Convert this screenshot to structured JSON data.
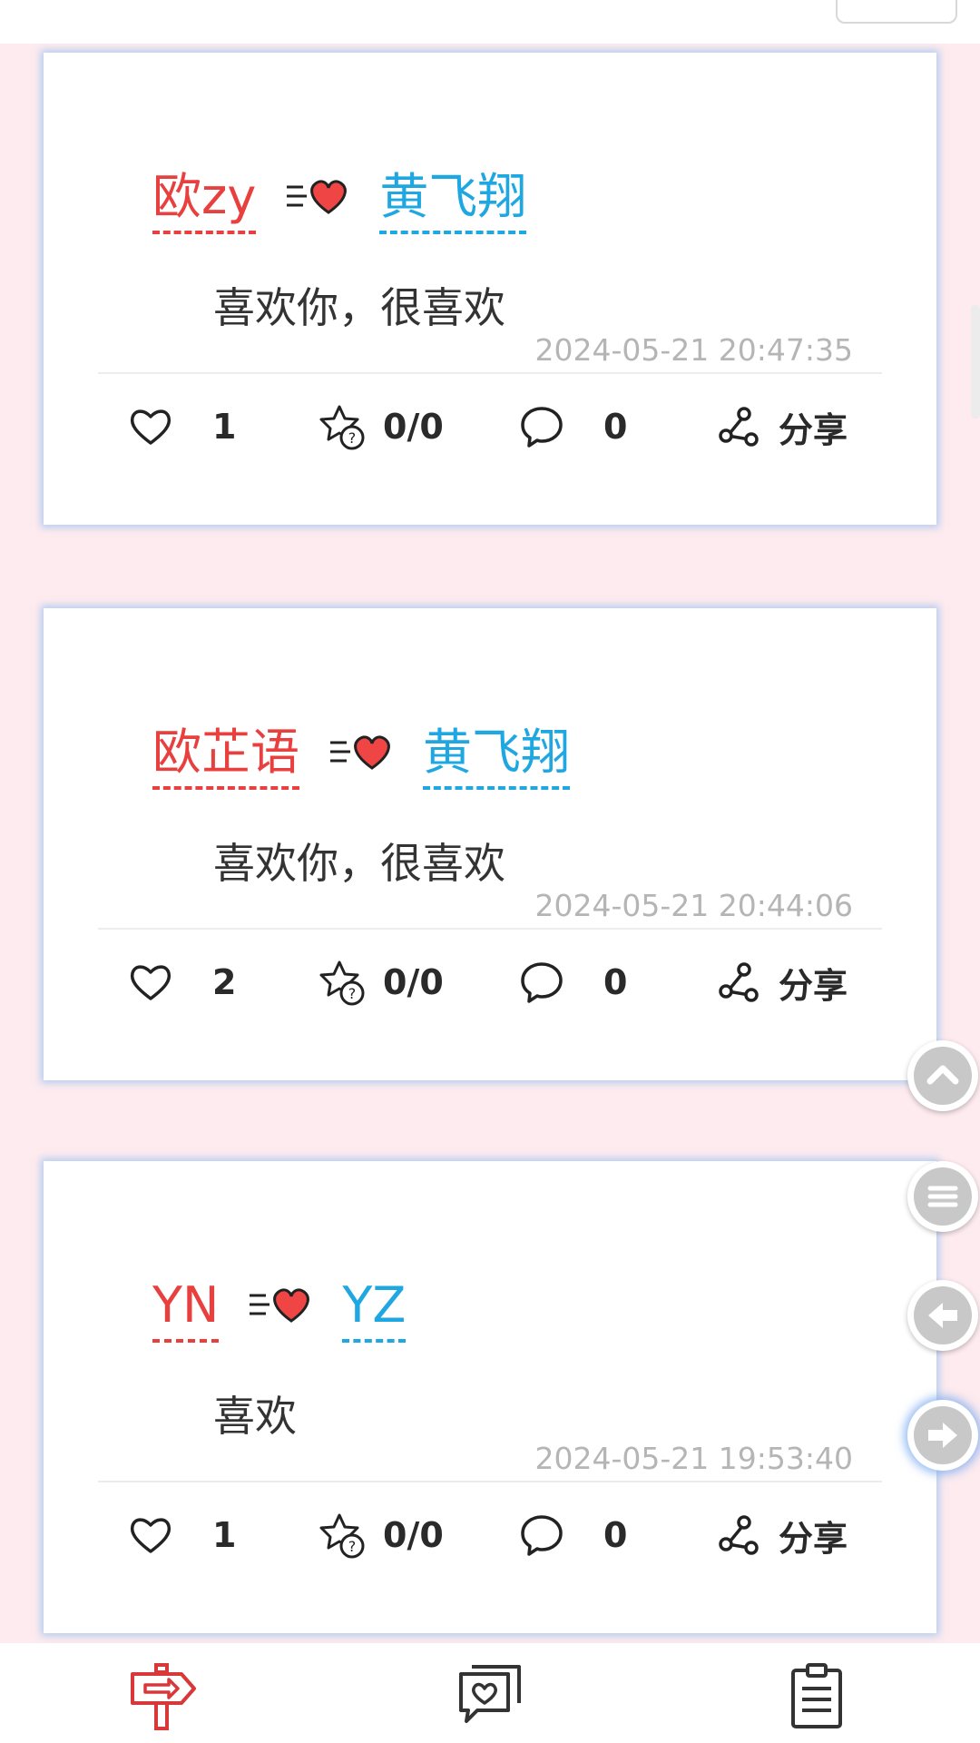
{
  "colors": {
    "background": "#fdebef",
    "from_name": "#e8403f",
    "to_name": "#1ea7e1",
    "timestamp": "#b5b5b5",
    "card_glow": "#78b4f0"
  },
  "feed": {
    "posts": [
      {
        "from": "欧zy",
        "to": "黄飞翔",
        "message": "喜欢你，很喜欢",
        "time": "2024-05-21 20:47:35",
        "likes": "1",
        "bets": "0/0",
        "comments": "0",
        "share": "分享"
      },
      {
        "from": "欧芷语",
        "to": "黄飞翔",
        "message": "喜欢你，很喜欢",
        "time": "2024-05-21 20:44:06",
        "likes": "2",
        "bets": "0/0",
        "comments": "0",
        "share": "分享"
      },
      {
        "from": "YN",
        "to": "YZ",
        "message": "喜欢",
        "time": "2024-05-21 19:53:40",
        "likes": "1",
        "bets": "0/0",
        "comments": "0",
        "share": "分享"
      }
    ]
  },
  "floating_buttons": [
    {
      "icon": "chevron-up-icon"
    },
    {
      "icon": "menu-icon"
    },
    {
      "icon": "arrow-left-icon"
    },
    {
      "icon": "arrow-right-icon",
      "active": true
    }
  ],
  "bottom_nav": {
    "items": [
      {
        "icon": "signpost-icon",
        "active": true
      },
      {
        "icon": "love-message-icon",
        "active": false
      },
      {
        "icon": "clipboard-icon",
        "active": false
      }
    ]
  }
}
